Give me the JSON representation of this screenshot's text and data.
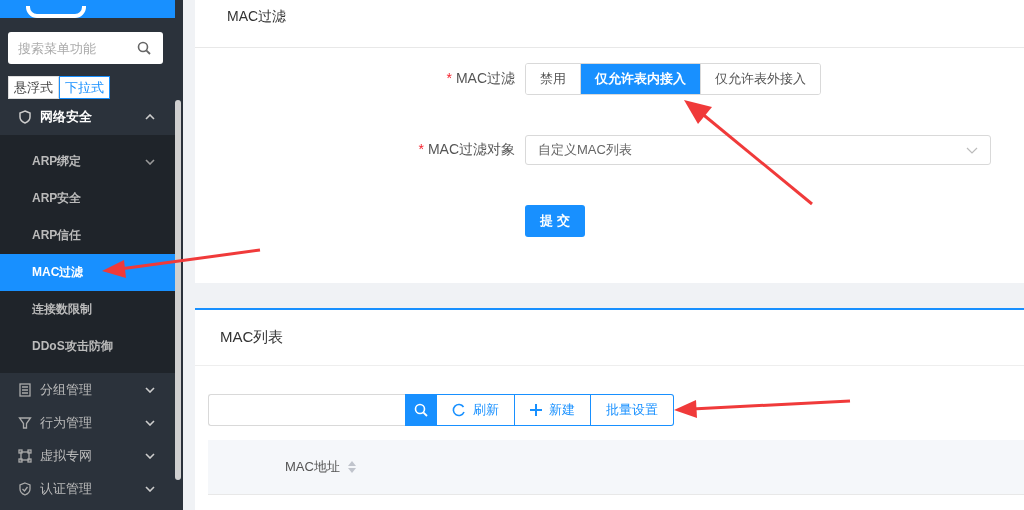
{
  "sidebar": {
    "search": {
      "placeholder": "搜索菜单功能"
    },
    "modes": [
      {
        "label": "悬浮式",
        "selected": false
      },
      {
        "label": "下拉式",
        "selected": true
      }
    ],
    "menu": [
      {
        "label": "网络安全",
        "expanded": true,
        "children": [
          {
            "label": "ARP绑定",
            "expandable": true,
            "selected": false
          },
          {
            "label": "ARP安全",
            "expandable": false,
            "selected": false
          },
          {
            "label": "ARP信任",
            "expandable": false,
            "selected": false
          },
          {
            "label": "MAC过滤",
            "expandable": false,
            "selected": true
          },
          {
            "label": "连接数限制",
            "expandable": false,
            "selected": false
          },
          {
            "label": "DDoS攻击防御",
            "expandable": false,
            "selected": false
          }
        ]
      },
      {
        "label": "分组管理",
        "expanded": false
      },
      {
        "label": "行为管理",
        "expanded": false
      },
      {
        "label": "虚拟专网",
        "expanded": false
      },
      {
        "label": "认证管理",
        "expanded": false
      }
    ]
  },
  "filter_card": {
    "title": "MAC过滤",
    "fields": [
      {
        "kind": "segmented",
        "label": "MAC过滤",
        "required_mark": "*",
        "options": [
          {
            "label": "禁用",
            "selected": false
          },
          {
            "label": "仅允许表内接入",
            "selected": true
          },
          {
            "label": "仅允许表外接入",
            "selected": false
          }
        ]
      },
      {
        "kind": "select",
        "label": "MAC过滤对象",
        "required_mark": "*",
        "value": "自定义MAC列表"
      }
    ],
    "submit": "提 交"
  },
  "list_card": {
    "title": "MAC列表",
    "toolbar": [
      {
        "kind": "refresh",
        "label": "刷新"
      },
      {
        "kind": "add",
        "label": "新建"
      },
      {
        "kind": "plain",
        "label": "批量设置"
      }
    ],
    "table": {
      "columns": [
        {
          "label": "MAC地址",
          "sortable": true
        }
      ]
    }
  }
}
